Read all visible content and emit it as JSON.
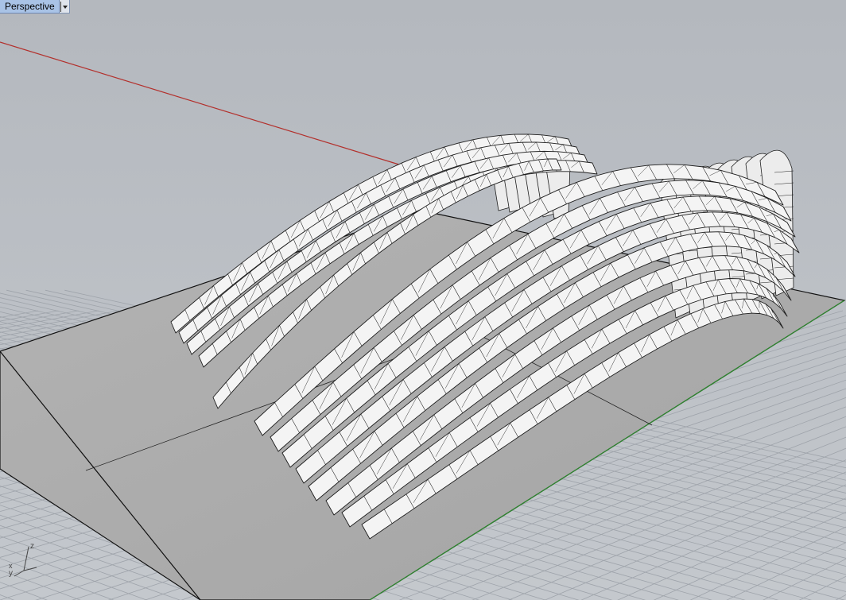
{
  "viewport": {
    "title": "Perspective",
    "menu_icon": "chevron-down-icon",
    "axis_labels": {
      "x": "x",
      "y": "y",
      "z": "z"
    }
  },
  "colors": {
    "viewport_bg": "#bfc3c9",
    "grid": "#9ea3aa",
    "grid_major": "#8c9199",
    "x_axis": "#b3302c",
    "y_axis": "#2e8b2e",
    "ground_plane": "#a8a8a8",
    "model_fill": "#f4f4f4",
    "model_edge": "#1e1e1e",
    "title_bg": "#a9c3e6"
  }
}
